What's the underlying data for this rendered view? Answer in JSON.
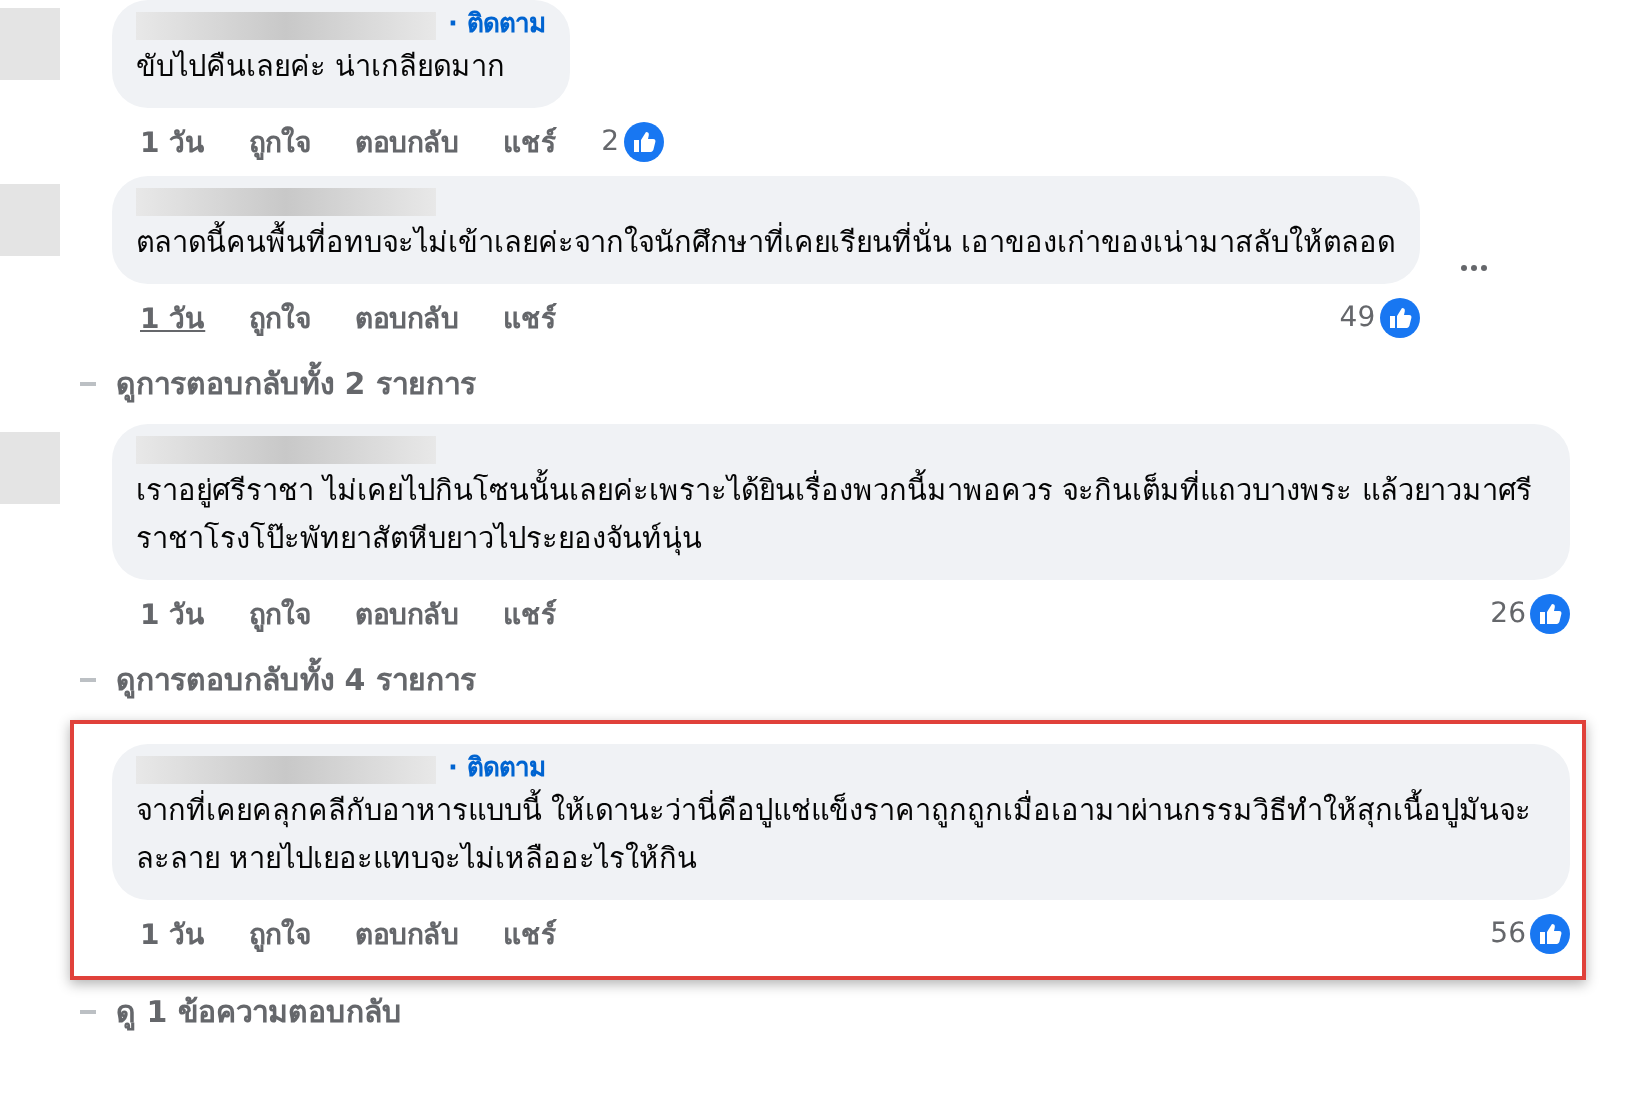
{
  "comments": [
    {
      "follow": "· ติดตาม",
      "text": "ขับไปคืนเลยค่ะ น่าเกลียดมาก",
      "highlighted": false,
      "time": "1 วัน",
      "time_hovered": false,
      "actions": [
        "ถูกใจ",
        "ตอบกลับ",
        "แชร์"
      ],
      "likes": "2"
    },
    {
      "text": "ตลาดนี้คนพื้นที่อทบจะไม่เข้าเลยค่ะจากใจนักศึกษาที่เคยเรียนที่นั่น เอาของเก่าของเน่ามาสลับให้ตลอด",
      "highlighted": false,
      "time": "1 วัน",
      "time_hovered": true,
      "actions": [
        "ถูกใจ",
        "ตอบกลับ",
        "แชร์"
      ],
      "likes": "49",
      "more": true,
      "replies": "ดูการตอบกลับทั้ง 2 รายการ"
    },
    {
      "text": "เราอยู่ศรีราชา ไม่เคยไปกินโซนนั้นเลยค่ะเพราะได้ยินเรื่องพวกนี้มาพอควร จะกินเต็มที่แถวบางพระ แล้วยาวมาศรีราชาโรงโป๊ะพัทยาสัตหีบยาวไประยองจันท์นุ่น",
      "highlighted": false,
      "time": "1 วัน",
      "time_hovered": false,
      "actions": [
        "ถูกใจ",
        "ตอบกลับ",
        "แชร์"
      ],
      "likes": "26",
      "replies": "ดูการตอบกลับทั้ง 4 รายการ"
    },
    {
      "follow": "· ติดตาม",
      "text": "จากที่เคยคลุกคลีกับอาหารแบบนี้ ให้เดานะว่านี่คือปูแช่แข็งราคาถูกถูกเมื่อเอามาผ่านกรรมวิธีทำให้สุกเนื้อปูมันจะ ละลาย หายไปเยอะแทบจะไม่เหลืออะไรให้กิน",
      "highlighted": true,
      "time": "1 วัน",
      "time_hovered": false,
      "actions": [
        "ถูกใจ",
        "ตอบกลับ",
        "แชร์"
      ],
      "likes": "56",
      "replies": "ดู 1 ข้อความตอบกลับ"
    }
  ]
}
